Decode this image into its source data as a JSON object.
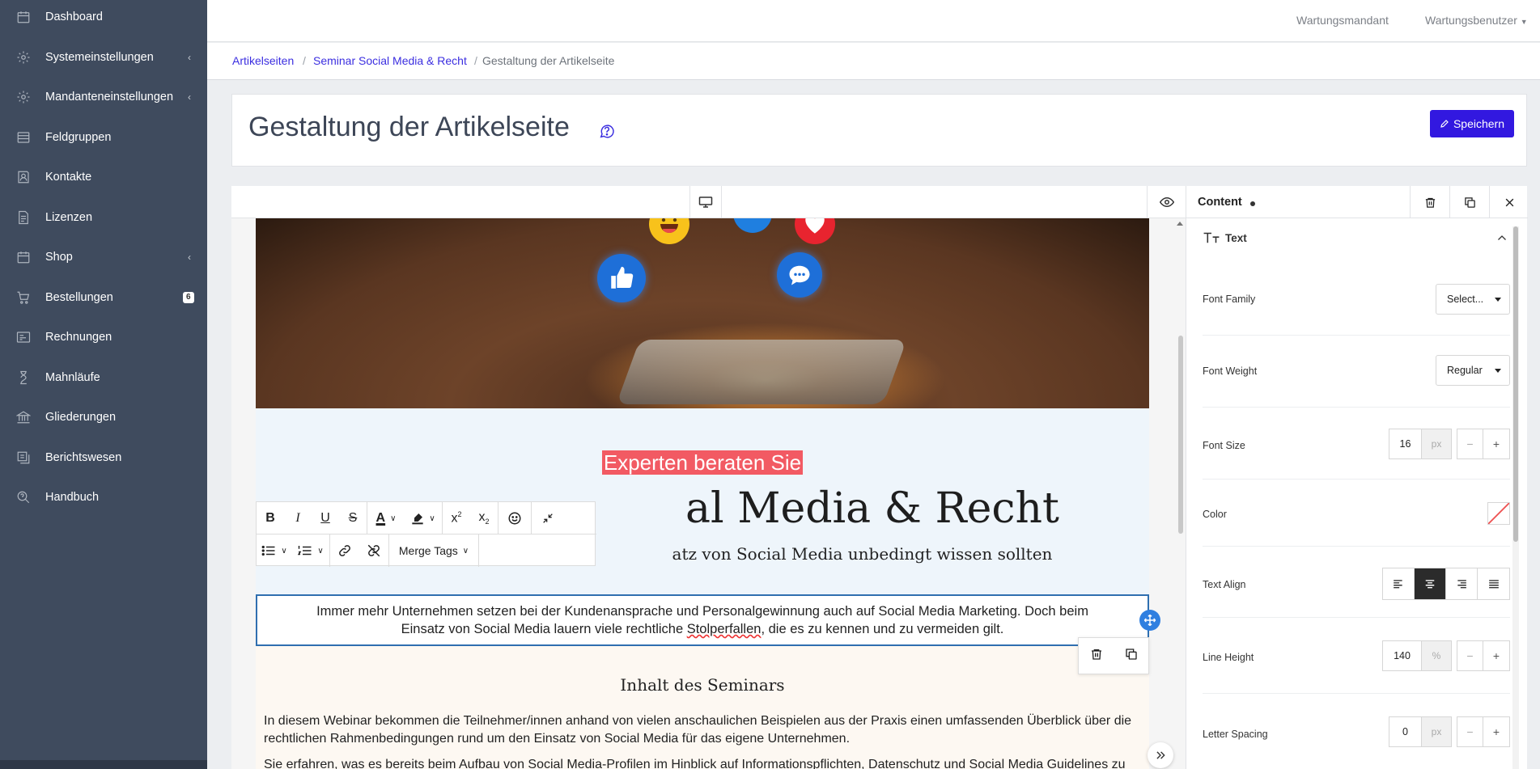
{
  "sidebar": {
    "items": [
      {
        "label": "Dashboard",
        "icon": "calendar-icon"
      },
      {
        "label": "Systemeinstellungen",
        "icon": "gear-icon",
        "chevron": "‹"
      },
      {
        "label": "Mandanteneinstellungen",
        "icon": "gear-icon",
        "chevron": "‹"
      },
      {
        "label": "Feldgruppen",
        "icon": "list-icon"
      },
      {
        "label": "Kontakte",
        "icon": "contacts-icon"
      },
      {
        "label": "Lizenzen",
        "icon": "document-icon"
      },
      {
        "label": "Shop",
        "icon": "calendar-icon",
        "chevron": "‹"
      },
      {
        "label": "Bestellungen",
        "icon": "cart-icon",
        "badge": "6"
      },
      {
        "label": "Rechnungen",
        "icon": "invoice-icon"
      },
      {
        "label": "Mahnläufe",
        "icon": "hourglass-icon"
      },
      {
        "label": "Gliederungen",
        "icon": "bank-icon"
      },
      {
        "label": "Berichtswesen",
        "icon": "reports-icon"
      },
      {
        "label": "Handbuch",
        "icon": "search-help-icon"
      }
    ]
  },
  "topbar": {
    "tenant": "Wartungsmandant",
    "user": "Wartungsbenutzer"
  },
  "breadcrumb": {
    "items": [
      "Artikelseiten",
      "Seminar Social Media & Recht",
      "Gestaltung der Artikelseite"
    ],
    "separator": "/"
  },
  "page": {
    "title": "Gestaltung der Artikelseite",
    "save_label": "Speichern"
  },
  "canvas": {
    "kicker": "Experten beraten Sie",
    "headline": "Social Media & Recht",
    "headline_visible": "al Media & Recht",
    "subheadline_visible": "atz von Social Media unbedingt wissen sollten",
    "selected_text_line1": "Immer mehr Unternehmen setzen bei der Kundenansprache und Personalgewinnung auch auf Social Media Marketing. Doch beim",
    "selected_text_line2_pre": "Einsatz von Social Media lauern viele rechtliche ",
    "selected_text_spell": "Stolperfallen",
    "selected_text_line2_post": ", die es zu kennen und zu vermeiden gilt.",
    "seminar_title": "Inhalt des Seminars",
    "seminar_para1": "In diesem Webinar bekommen die Teilnehmer/innen anhand von vielen anschaulichen Beispielen aus der Praxis einen umfassenden Überblick über die rechtlichen Rahmenbedingungen rund um den Einsatz von Social Media für das eigene Unternehmen.",
    "seminar_para2": "Sie erfahren, was es bereits beim Aufbau von Social Media-Profilen im Hinblick auf Informationspflichten, Datenschutz und Social Media Guidelines zu beachten gilt und welche rechtlichen Aspekte im Hinblick auf Urheberrechte, Recht am eigenen Bild etc. beim Veröffentlichen von Inhalten"
  },
  "format_toolbar": {
    "merge_tags_label": "Merge Tags"
  },
  "properties": {
    "panel_title": "Content",
    "section_title": "Text",
    "font_family_label": "Font Family",
    "font_family_value": "Select...",
    "font_weight_label": "Font Weight",
    "font_weight_value": "Regular",
    "font_size_label": "Font Size",
    "font_size_value": "16",
    "font_size_unit": "px",
    "color_label": "Color",
    "text_align_label": "Text Align",
    "text_align_value": "center",
    "line_height_label": "Line Height",
    "line_height_value": "140",
    "line_height_unit": "%",
    "letter_spacing_label": "Letter Spacing",
    "letter_spacing_value": "0",
    "letter_spacing_unit": "px",
    "minus": "−",
    "plus": "+"
  },
  "colors": {
    "sidebar_bg": "#3f4b5e",
    "accent": "#3218e0",
    "link": "#3b2ee0",
    "kicker_bg": "#f25a63",
    "selection_border": "#2f6fb0"
  }
}
